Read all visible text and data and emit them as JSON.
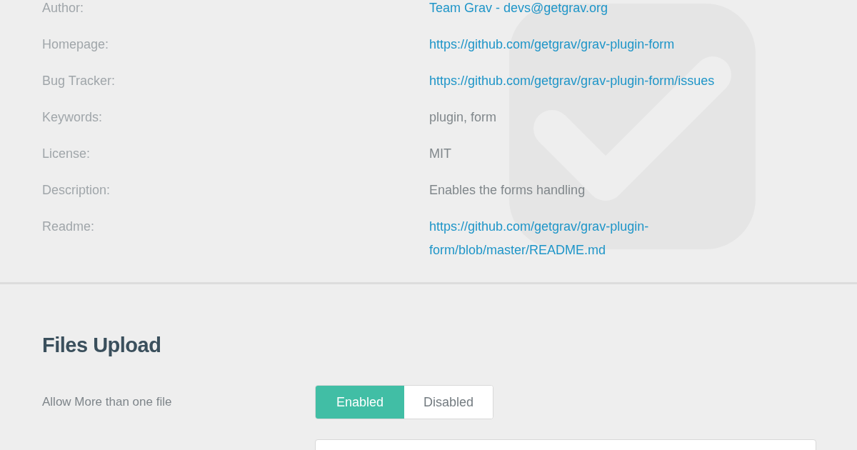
{
  "info": [
    {
      "label": "Author:",
      "value": "Team Grav - devs@getgrav.org",
      "kind": "link"
    },
    {
      "label": "Homepage:",
      "value": "https://github.com/getgrav/grav-plugin-form",
      "kind": "link"
    },
    {
      "label": "Bug Tracker:",
      "value": "https://github.com/getgrav/grav-plugin-form/issues",
      "kind": "link"
    },
    {
      "label": "Keywords:",
      "value": "plugin, form",
      "kind": "text"
    },
    {
      "label": "License:",
      "value": "MIT",
      "kind": "text"
    },
    {
      "label": "Description:",
      "value": "Enables the forms handling",
      "kind": "text"
    },
    {
      "label": "Readme:",
      "value": "https://github.com/getgrav/grav-plugin-form/blob/master/README.md",
      "kind": "link"
    }
  ],
  "section": {
    "title": "Files Upload",
    "fields": [
      {
        "label": "Allow More than one file",
        "kind": "toggle",
        "options": [
          {
            "label": "Enabled",
            "selected": true
          },
          {
            "label": "Disabled",
            "selected": false
          }
        ]
      },
      {
        "kind": "input"
      }
    ]
  }
}
